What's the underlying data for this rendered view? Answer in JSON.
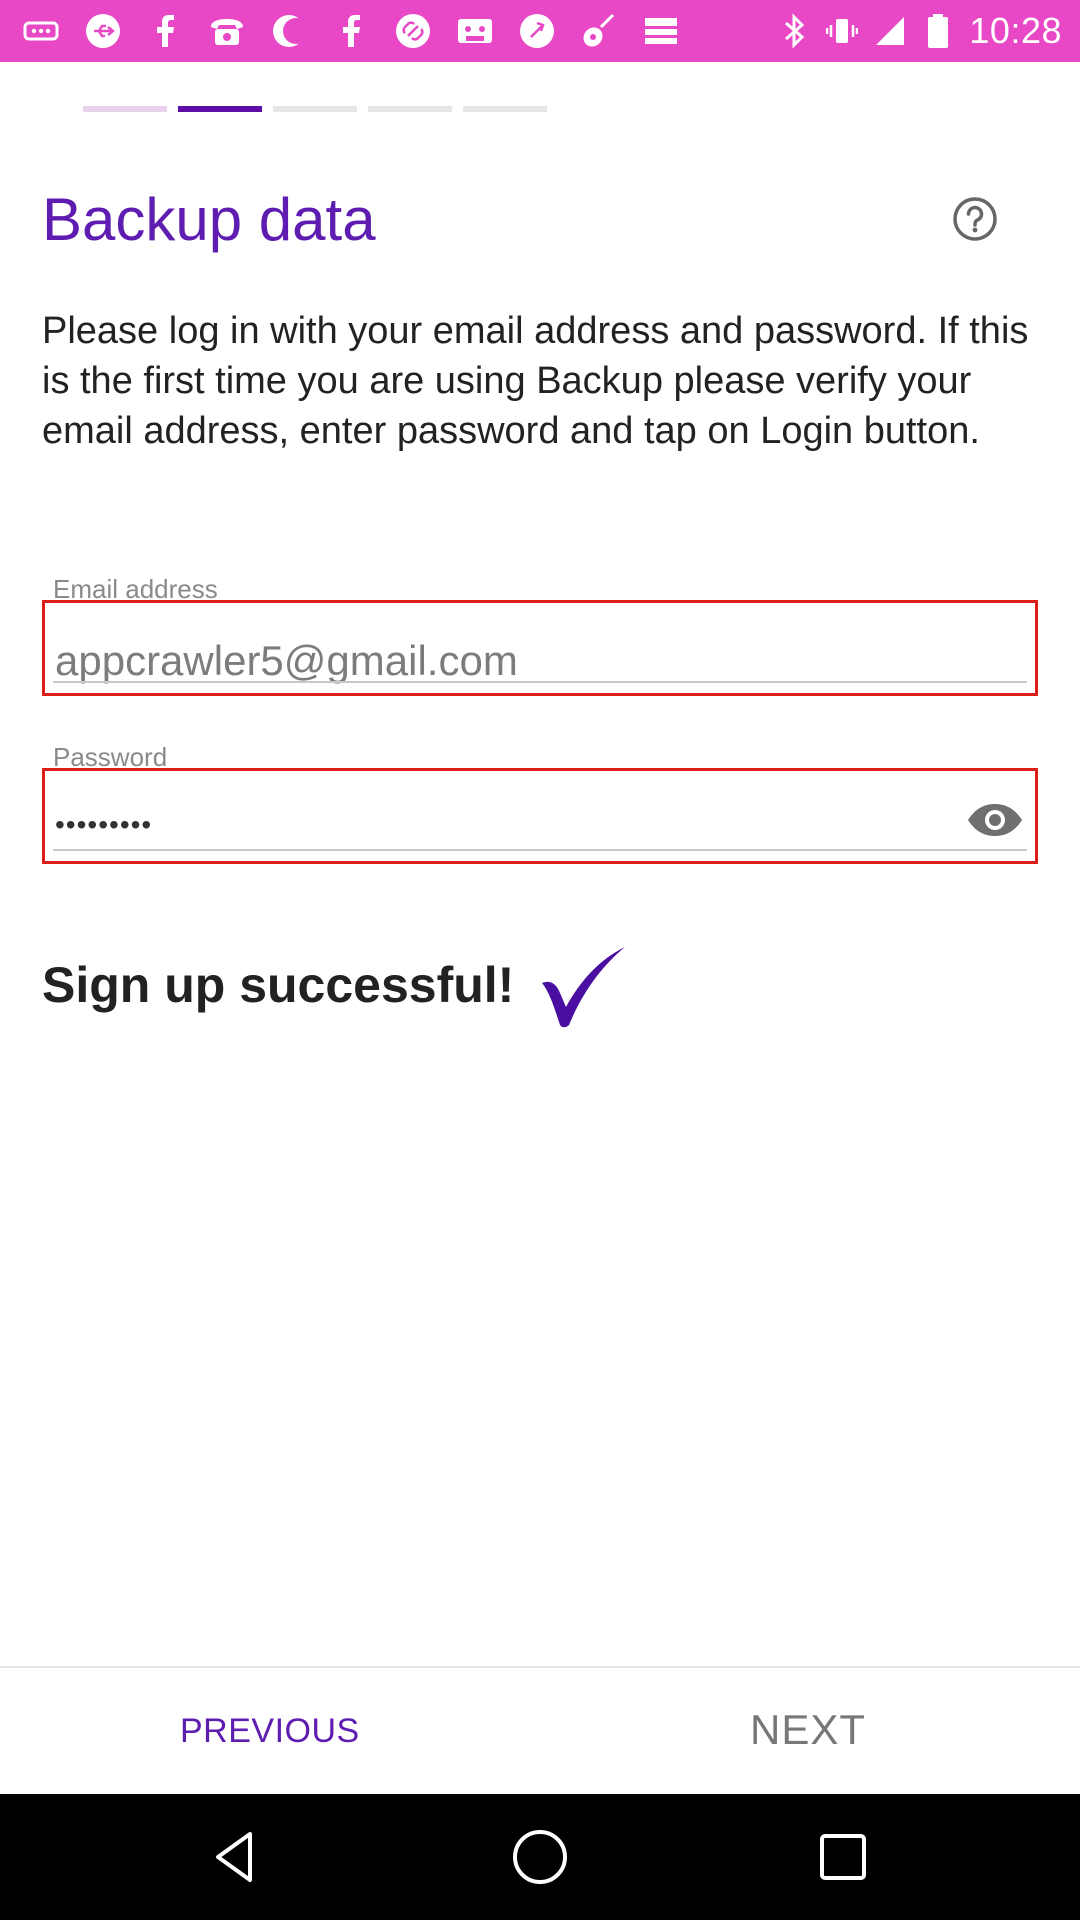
{
  "status_bar": {
    "time": "10:28",
    "notification_icons": [
      "more-dots-icon",
      "usb-icon",
      "facebook-icon",
      "phone-icon",
      "moon-icon",
      "facebook-icon",
      "link-icon",
      "cassette-icon",
      "dial-icon",
      "guitar-icon",
      "ticket-icon"
    ],
    "system_icons": [
      "bluetooth-icon",
      "vibrate-icon",
      "signal-icon",
      "battery-icon"
    ],
    "background_color": "#e848c6"
  },
  "steps": {
    "count": 5,
    "active_index": 1
  },
  "header": {
    "title": "Backup data",
    "help_icon": "help-circle-icon"
  },
  "instructions": "Please log in with your email address and password. If this is the first time you are using Backup please verify your email address, enter password and tap on Login button.",
  "form": {
    "email": {
      "label": "Email address",
      "value": "appcrawler5@gmail.com"
    },
    "password": {
      "label": "Password",
      "value": "•••••••••",
      "toggle_icon": "eye-icon"
    }
  },
  "status": {
    "message": "Sign up successful!",
    "icon": "checkmark-icon"
  },
  "navigation": {
    "previous_label": "PREVIOUS",
    "next_label": "NEXT"
  },
  "colors": {
    "accent": "#5e1cb0",
    "error_border": "#e01c1c"
  }
}
